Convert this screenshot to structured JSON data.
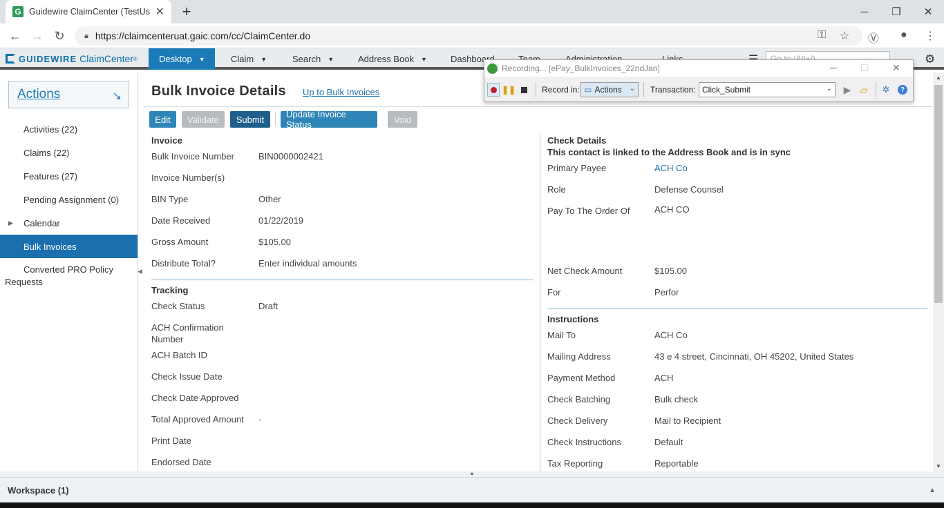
{
  "browser": {
    "tab_title": "Guidewire ClaimCenter (TestUser",
    "tab_icon": "G",
    "url": "https://claimcenteruat.gaic.com/cc/ClaimCenter.do"
  },
  "app": {
    "brand": "GUIDEWIRE",
    "product": "ClaimCenter",
    "product_mark": "®",
    "nav": [
      "Desktop",
      "Claim",
      "Search",
      "Address Book",
      "Dashboard",
      "Team",
      "Administration",
      "Links"
    ],
    "search_placeholder": "Go to (Alt+/)"
  },
  "left_panel": {
    "actions_label": "Actions",
    "items": [
      {
        "label": "Activities (22)"
      },
      {
        "label": "Claims (22)"
      },
      {
        "label": "Features (27)"
      },
      {
        "label": "Pending Assignment (0)"
      },
      {
        "label": "Calendar"
      },
      {
        "label": "Bulk Invoices"
      },
      {
        "label": "Converted PRO Policy Requests"
      }
    ]
  },
  "page": {
    "title": "Bulk Invoice Details",
    "up_link": "Up to Bulk Invoices",
    "buttons": {
      "edit": "Edit",
      "validate": "Validate",
      "submit": "Submit",
      "update_status": "Update Invoice Status",
      "void": "Void"
    }
  },
  "invoice": {
    "heading": "Invoice",
    "fields": [
      {
        "label": "Bulk Invoice Number",
        "value": "BIN0000002421"
      },
      {
        "label": "Invoice Number(s)",
        "value": ""
      },
      {
        "label": "BIN Type",
        "value": "Other"
      },
      {
        "label": "Date Received",
        "value": "01/22/2019"
      },
      {
        "label": "Gross Amount",
        "value": "$105.00"
      },
      {
        "label": "Distribute Total?",
        "value": "Enter individual amounts"
      }
    ]
  },
  "tracking": {
    "heading": "Tracking",
    "fields": [
      {
        "label": "Check Status",
        "value": "Draft"
      },
      {
        "label": "ACH Confirmation Number",
        "value": ""
      },
      {
        "label": "ACH Batch ID",
        "value": ""
      },
      {
        "label": "Check Issue Date",
        "value": ""
      },
      {
        "label": "Check Date Approved",
        "value": ""
      },
      {
        "label": "Total Approved Amount",
        "value": "-"
      },
      {
        "label": "Print Date",
        "value": ""
      },
      {
        "label": "Endorsed Date",
        "value": ""
      }
    ]
  },
  "check_details": {
    "heading": "Check Details",
    "sync_note": "This contact is linked to the Address Book and is in sync",
    "fields": [
      {
        "label": "Primary Payee",
        "value": "ACH Co"
      },
      {
        "label": "Role",
        "value": "Defense Counsel"
      },
      {
        "label": "Pay To The Order Of",
        "value": "ACH CO"
      },
      {
        "label": "Net Check Amount",
        "value": "$105.00"
      },
      {
        "label": "For",
        "value": "Perfor"
      }
    ]
  },
  "instructions": {
    "heading": "Instructions",
    "fields": [
      {
        "label": "Mail To",
        "value": "ACH Co"
      },
      {
        "label": "Mailing Address",
        "value": "43 e 4 street, Cincinnati, OH 45202, United States"
      },
      {
        "label": "Payment Method",
        "value": "ACH"
      },
      {
        "label": "Check Batching",
        "value": "Bulk check"
      },
      {
        "label": "Check Delivery",
        "value": "Mail to Recipient"
      },
      {
        "label": "Check Instructions",
        "value": "Default"
      },
      {
        "label": "Tax Reporting",
        "value": "Reportable"
      }
    ]
  },
  "workspace": {
    "label": "Workspace (1)"
  },
  "recorder": {
    "title": "Recording... [ePay_BulkInvoices_22ndJan]",
    "record_in_label": "Record in:",
    "record_in_value": "Actions",
    "transaction_label": "Transaction:",
    "transaction_value": "Click_Submit"
  },
  "colors": {
    "accent": "#1b7ab8",
    "selected_nav": "#1b6fae",
    "button_primary": "#2e86b8",
    "button_disabled": "#b6bcc0"
  }
}
